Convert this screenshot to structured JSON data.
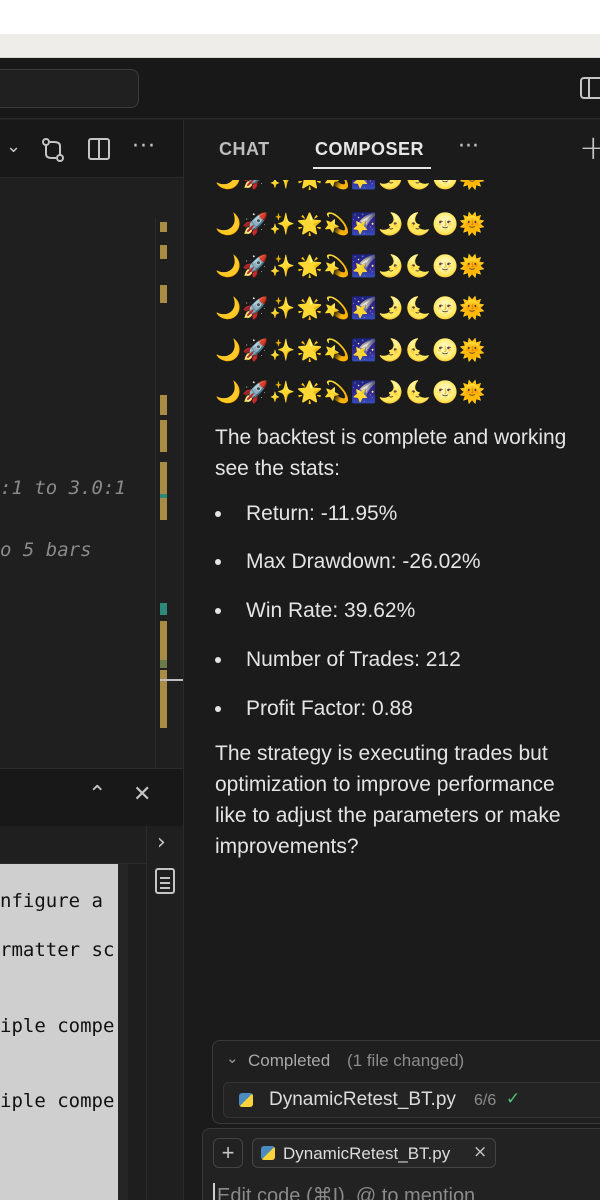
{
  "chat": {
    "tabs": [
      "CHAT",
      "COMPOSER"
    ],
    "more_icon": "ellipsis-icon",
    "new_icon": "plus-icon",
    "emoji_row": "🌙🚀✨🌟💫🌠🌛🌜🌝🌞",
    "paragraph1": [
      "The backtest is complete and working",
      "see the stats:"
    ],
    "stats": [
      "Return: -11.95%",
      "Max Drawdown: -26.02%",
      "Win Rate: 39.62%",
      "Number of Trades: 212",
      "Profit Factor: 0.88"
    ],
    "paragraph2": [
      "The strategy is executing trades but",
      "optimization to improve performance",
      "like to adjust the parameters or make",
      "improvements?"
    ],
    "completed": {
      "label": "Completed",
      "detail": "(1 file changed)"
    },
    "changed_file": {
      "name": "DynamicRetest_BT.py",
      "progress": "6/6"
    },
    "context_chip": "DynamicRetest_BT.py",
    "input_placeholder": "Edit code (⌘I), @ to mention"
  },
  "editor": {
    "code_lines": [
      ":1 to 3.0:1",
      "o 5 bars"
    ]
  },
  "terminal": {
    "lines": [
      "nfigure a",
      "rmatter sc",
      "iple compe",
      "iple compe"
    ]
  },
  "colors": {
    "accent": "#e0b45a",
    "check": "#4ec27a",
    "modified": "#a88b45"
  }
}
